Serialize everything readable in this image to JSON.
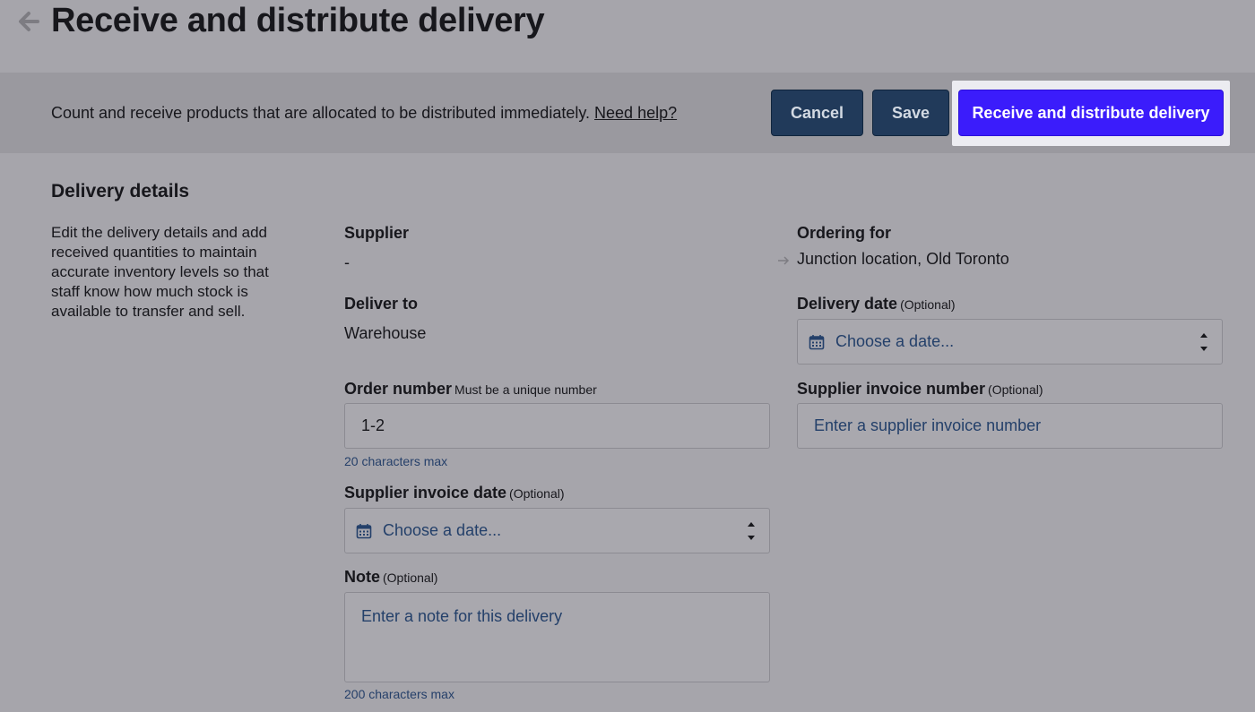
{
  "header": {
    "title": "Receive and distribute delivery",
    "back_icon": "arrow-left-icon"
  },
  "action_bar": {
    "description": "Count and receive products that are allocated to be distributed immediately.",
    "help_link": "Need help?",
    "cancel_label": "Cancel",
    "save_label": "Save",
    "primary_label": "Receive and distribute delivery"
  },
  "colors": {
    "primary_button": "#3b1cfb",
    "secondary_button": "#213a5a",
    "highlight": "#ececf1"
  },
  "delivery_details": {
    "title": "Delivery details",
    "description": "Edit the delivery details and add received quantities to maintain accurate inventory levels so that staff know how much stock is available to transfer and sell.",
    "supplier": {
      "label": "Supplier",
      "value": "-"
    },
    "ordering_for": {
      "label": "Ordering for",
      "value": "Junction location, Old Toronto"
    },
    "deliver_to": {
      "label": "Deliver to",
      "value": "Warehouse"
    },
    "delivery_date": {
      "label": "Delivery date",
      "sub": "(Optional)",
      "placeholder": "Choose a date..."
    },
    "order_number": {
      "label": "Order number",
      "sub": "Must be a unique number",
      "value": "1-2",
      "hint": "20 characters max"
    },
    "supplier_invoice_number": {
      "label": "Supplier invoice number",
      "sub": "(Optional)",
      "placeholder": "Enter a supplier invoice number"
    },
    "supplier_invoice_date": {
      "label": "Supplier invoice date",
      "sub": "(Optional)",
      "placeholder": "Choose a date..."
    },
    "note": {
      "label": "Note",
      "sub": "(Optional)",
      "placeholder": "Enter a note for this delivery",
      "hint": "200 characters max"
    }
  }
}
